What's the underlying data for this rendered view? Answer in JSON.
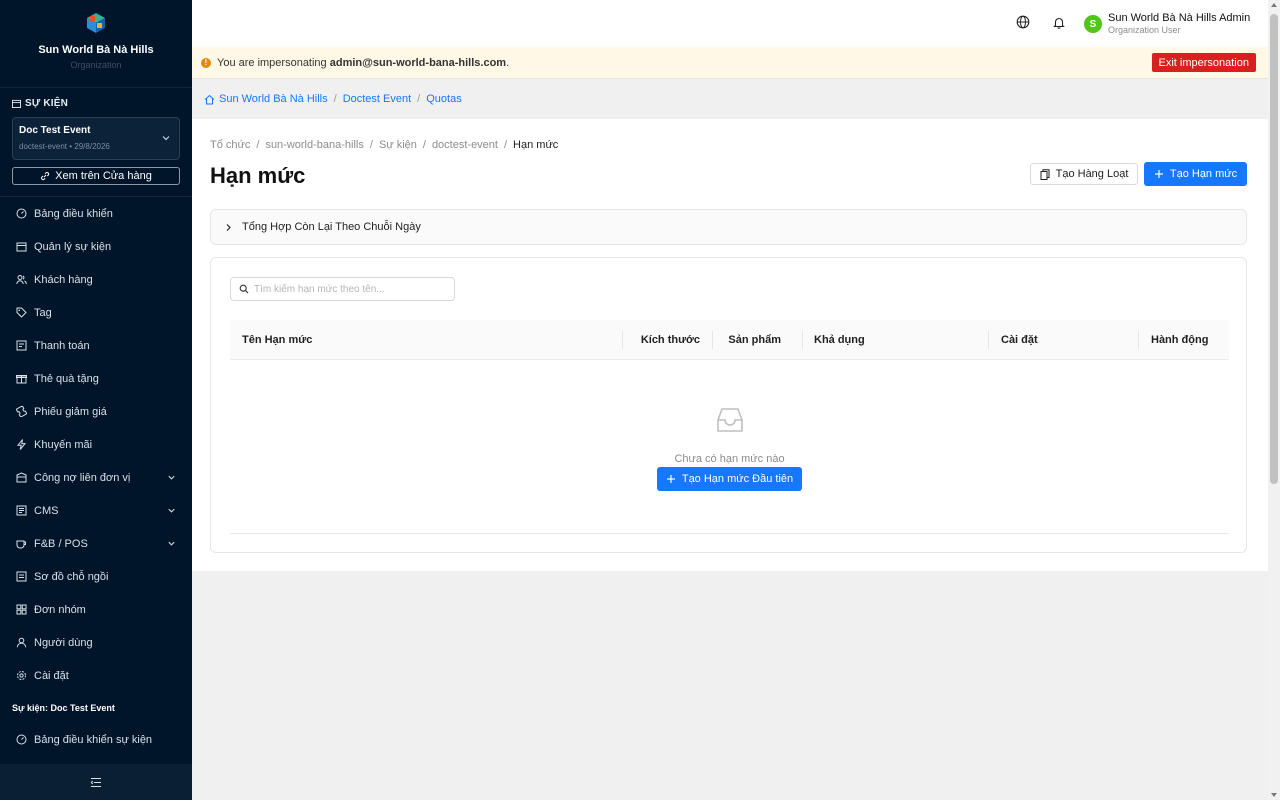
{
  "brand": {
    "name": "Sun World Bà Nà Hills",
    "subtitle": "Organization"
  },
  "sidebar": {
    "section_label": "SỰ KIỆN",
    "event": {
      "name": "Doc Test Event",
      "meta": "doctest-event • 29/8/2026"
    },
    "store_button": "Xem trên Cửa hàng",
    "items": [
      {
        "label": "Bảng điều khiển",
        "icon": "dashboard-icon"
      },
      {
        "label": "Quản lý sự kiện",
        "icon": "calendar-icon"
      },
      {
        "label": "Khách hàng",
        "icon": "users-icon"
      },
      {
        "label": "Tag",
        "icon": "tag-icon"
      },
      {
        "label": "Thanh toán",
        "icon": "payment-icon"
      },
      {
        "label": "Thẻ quà tặng",
        "icon": "gift-icon"
      },
      {
        "label": "Phiếu giảm giá",
        "icon": "coupon-icon"
      },
      {
        "label": "Khuyến mãi",
        "icon": "lightning-icon"
      },
      {
        "label": "Công nợ liên đơn vị",
        "icon": "debt-icon"
      },
      {
        "label": "CMS",
        "icon": "cms-icon"
      },
      {
        "label": "F&B / POS",
        "icon": "coffee-icon"
      },
      {
        "label": "Sơ đồ chỗ ngồi",
        "icon": "seat-map-icon"
      },
      {
        "label": "Đơn nhóm",
        "icon": "grid-icon"
      },
      {
        "label": "Người dùng",
        "icon": "user-icon"
      },
      {
        "label": "Cài đặt",
        "icon": "gear-icon"
      }
    ],
    "event_section_label": "Sự kiện: Doc Test Event",
    "event_items": [
      {
        "label": "Bảng điều khiển sự kiện",
        "icon": "dashboard-icon"
      }
    ]
  },
  "header": {
    "user_name": "Sun World Bà Nà Hills Admin",
    "user_role": "Organization User",
    "avatar_letter": "S"
  },
  "impersonation": {
    "prefix": "You are impersonating ",
    "email": "admin@sun-world-bana-hills.com",
    "suffix": ".",
    "exit_label": "Exit impersonation"
  },
  "top_breadcrumb": [
    "Sun World Bà Nà Hills",
    "Doctest Event",
    "Quotas"
  ],
  "breadcrumb": [
    "Tổ chức",
    "sun-world-bana-hills",
    "Sự kiện",
    "doctest-event",
    "Hạn mức"
  ],
  "page": {
    "title": "Hạn mức",
    "bulk_button": "Tạo Hàng Loạt",
    "create_button": "Tạo Hạn mức",
    "collapse_label": "Tổng Hợp Còn Lại Theo Chuỗi Ngày",
    "search_placeholder": "Tìm kiếm hạn mức theo tên...",
    "columns": [
      "Tên Hạn mức",
      "Kích thước",
      "Sản phẩm",
      "Khả dụng",
      "Cài đặt",
      "Hành động"
    ],
    "empty_text": "Chưa có hạn mức nào",
    "empty_button": "Tạo Hạn mức Đầu tiên"
  },
  "colors": {
    "sidebar_bg": "#001529",
    "primary": "#1677ff",
    "danger": "#d9201e",
    "warning_bg": "#fff8e6",
    "avatar": "#52c41a"
  }
}
